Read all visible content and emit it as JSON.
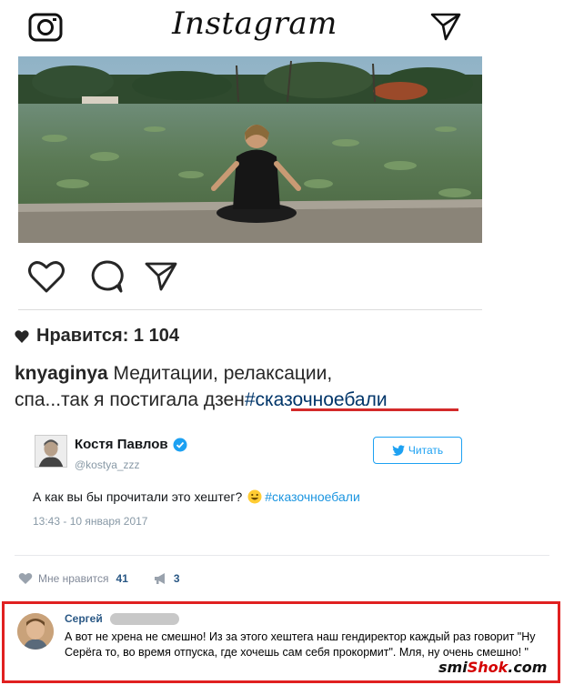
{
  "instagram": {
    "logo_text": "Instagram",
    "likes_label": "Нравится: 1 104",
    "caption_user": "knyaginya",
    "caption_text_1": " Медитации, релаксации,",
    "caption_text_2": "спа...так я постигала дзен",
    "caption_hashtag": "#сказочноебали"
  },
  "tweet": {
    "author_name": "Костя Павлов",
    "author_handle": "@kostya_zzz",
    "follow_label": "Читать",
    "text": "А как вы бы прочитали это хештег?",
    "hashtag": "#сказочноебали",
    "timestamp": "13:43 - 10 января 2017"
  },
  "vk_post": {
    "like_label": "Мне нравится",
    "like_count": "41",
    "share_count": "3"
  },
  "comment": {
    "author": "Сергей",
    "text": "А вот не хрена не смешно! Из за этого хештега наш гендиректор каждый раз говорит \"Ну Серёга то, во время отпуска, где хочешь сам себя прокормит\". Мля, ну очень смешно! \""
  },
  "watermark": {
    "part1": "smi",
    "part2": "Shok",
    "part3": ".com"
  },
  "colors": {
    "accent_red": "#e02020",
    "vk_blue": "#2a5885",
    "twitter_blue": "#1da1f2"
  }
}
